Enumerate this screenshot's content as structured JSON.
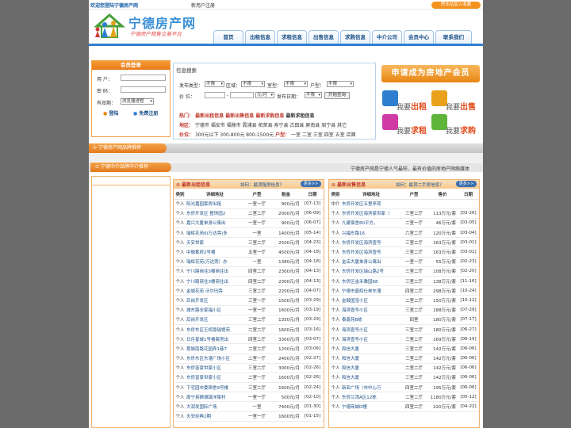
{
  "topbar": {
    "welcome": "欢迎您登陆宁德房产网",
    "register": "新用户注册",
    "favorite": "把本站加入收藏"
  },
  "logo": {
    "title": "宁德房产网",
    "slogan": "宁德房产租售交易平台"
  },
  "nav": [
    "首页",
    "出租信息",
    "求租信息",
    "出售信息",
    "求购信息",
    "中介公司",
    "会员中心",
    "联系我们"
  ],
  "login": {
    "header": "会员登录",
    "user_label": "用 户：",
    "password_label": "密 码：",
    "validity_label": "有效期：",
    "validity_value": "浏览器进程",
    "login_button": "登陆",
    "register_button": "免费注册"
  },
  "search": {
    "header": "信息搜索",
    "row1": {
      "type_label": "发布类型：",
      "type_value": "不限",
      "district_label": "区域：",
      "district_value": "不限",
      "rooms_label": "室型：",
      "rooms_value": "不限",
      "house_label": "户型：",
      "house_value": "不限"
    },
    "row2": {
      "price_label": "价    位：",
      "dash": "-",
      "unit_value": "元/月",
      "date_label": "发布日期：",
      "date_value": "不限",
      "button": "开始查询"
    },
    "hot": {
      "label": "热门：",
      "links": [
        "最新出租信息",
        "最新出售信息",
        "最新求购信息",
        "最新求租信息"
      ]
    },
    "district": {
      "label": "地区：",
      "text": "宁德市 福安市 福鼎市 霞浦县 柘荣县 寿宁县 古田县 屏南县 周宁县 其它"
    },
    "price": {
      "label": "价位：",
      "text": "300元以下 300-800元 800-1500元",
      "rooms_label": "户型：",
      "rooms_text": "一室 二室 三室 四室 五室 店面"
    }
  },
  "member": {
    "join": "申请成为房地产会员",
    "actions": [
      {
        "pre": "我要",
        "word": "出租",
        "color": "#2f7fd0"
      },
      {
        "pre": "我要",
        "word": "出售",
        "color": "#e9a11c"
      },
      {
        "pre": "我要",
        "word": "求租",
        "color": "#d03aa4"
      },
      {
        "pre": "我要",
        "word": "求购",
        "color": "#5fb53a"
      }
    ]
  },
  "promo": {
    "tag": "宁德房产网品牌推荐"
  },
  "agents": {
    "tag": "宁德中介品牌中介推荐",
    "marquee": "宁德房产网是宁德人气最旺、最有价值的房地产网络媒体"
  },
  "rent": {
    "title": "最新出租信息",
    "question": "如何：最顶租房信息？",
    "more": "更多>>",
    "headers": [
      "类别",
      "详细地址",
      "户型",
      "租金",
      "日期"
    ],
    "rows": [
      [
        "个人",
        "阳光嘉园套房出租",
        "一室一厅",
        "900元/月",
        "[07-13]"
      ],
      [
        "个人",
        "东侨开发区 整饰园2",
        "二室二厅",
        "2000元/月",
        "[06-09]"
      ],
      [
        "个人",
        "嘉兴大厦单身公寓出",
        "一室一厅",
        "900元/月",
        "[06-07]"
      ],
      [
        "个人",
        "瑞辉花苑6(万达旁)多",
        "一室",
        "1400元/月",
        "[05-14]"
      ],
      [
        "个人",
        "天安世家",
        "三室二厅",
        "2500元/月",
        "[04-23]"
      ],
      [
        "个人",
        "中融紫府2号楼",
        "五室一厅",
        "4500元/月",
        "[04-18]"
      ],
      [
        "个人",
        "瑞辉花苑(万达旁）办",
        "一室",
        "1380元/月",
        "[04-18]"
      ],
      [
        "个人",
        "宁川路商住3楼商住出",
        "四室二厅",
        "2300元/月",
        "[04-13]"
      ],
      [
        "个人",
        "宁川路商住3楼商住出",
        "四室二厅",
        "2300元/月",
        "[04-13]"
      ],
      [
        "个人",
        "金城花苑 沃尔玛旁",
        "三室二厅",
        "2200元/月",
        "[04-07]"
      ],
      [
        "个人",
        "后岗开发区",
        "三室一厅",
        "1500元/月",
        "[03-29]"
      ],
      [
        "个人",
        "城东路全家福小区",
        "一室一厅",
        "1600元/月",
        "[03-19]"
      ],
      [
        "个人",
        "后岗开发区",
        "三室二厅",
        "1350元/月",
        "[03-29]"
      ],
      [
        "个人",
        "东侨东区王机隐瑞馆苑",
        "二室二厅",
        "1600元/月",
        "[03-16]"
      ],
      [
        "个人",
        "日月星城1号楼套房出",
        "四室二厅",
        "3300元/月",
        "[03-07]"
      ],
      [
        "个人",
        "蕉城南路花园弄1巷7",
        "二室二厅",
        "1200元/月",
        "[03-06]"
      ],
      [
        "个人",
        "东侨东区东港广场小区",
        "二室一厅",
        "2400元/月",
        "[02-27]"
      ],
      [
        "个人",
        "东侨富豪世家小区",
        "三室二厅",
        "3000元/月",
        "[02-26]"
      ],
      [
        "个人",
        "东侨富豪世家小区",
        "二室一厅",
        "1600元/月",
        "[02-26]"
      ],
      [
        "个人",
        "下宅园市委宿舍9号楼",
        "三室二厅",
        "1600元/月",
        "[02-24]"
      ],
      [
        "个人",
        "周宁县狮城镇洋尾村",
        "一室一厅",
        "500元/月",
        "[02-10]"
      ],
      [
        "个人",
        "大润发国际广场",
        "一室",
        "7400元/月",
        "[01-30]"
      ],
      [
        "个人",
        "天安经典2期",
        "一室一厅",
        "1600元/月",
        "[01-15]"
      ]
    ]
  },
  "sale": {
    "title": "最新出售信息",
    "question": "如何：最顶二手房信息？",
    "more": "更多>>",
    "headers": [
      "类别",
      "详细地址",
      "户型",
      "售价",
      "日期"
    ],
    "rows": [
      [
        "中介",
        "东侨开发区五里亭荷",
        "",
        "",
        ""
      ],
      [
        "个人",
        "东侨开发区海滨豪世家（",
        "三室二厅",
        "113万元/套",
        "[03-26]"
      ],
      [
        "个人",
        "九建宿舍80平方，",
        "二室一厅",
        "46万元/套",
        "[03-05]"
      ],
      [
        "个人",
        "兴福东路16",
        "六室二厅",
        "120万元/套",
        "[03-04]"
      ],
      [
        "个人",
        "东侨开发区海滨壹号",
        "三室二厅",
        "163万元/套",
        "[03-01]"
      ],
      [
        "个人",
        "东侨开发区海滨壹号",
        "三室二厅",
        "163万元/套",
        "[03-01]"
      ],
      [
        "个人",
        "金店大厦单身公寓出",
        "一室一厅",
        "55万元/套",
        "[02-23]"
      ],
      [
        "个人",
        "东侨开发区瑞山路2号",
        "三室二厅",
        "108万元/套",
        "[02-20]"
      ],
      [
        "个人",
        "东侨区金禾雅园68",
        "三室二厅",
        "138万元/套",
        "[11-16]"
      ],
      [
        "个人",
        "宁德市盛辉仕林东涌",
        "四室二厅",
        "298万元/套",
        "[10-24]"
      ],
      [
        "个人",
        "金鼓国宝小区",
        "二室二厅",
        "150万元/套",
        "[10-12]"
      ],
      [
        "个人",
        "海滨壹号小区",
        "三室二厅",
        "188万元/套",
        "[07-29]"
      ],
      [
        "个人",
        "泰鑫苑B栋",
        "四室",
        "180万元/套",
        "[07-17]"
      ],
      [
        "个人",
        "海滨壹号小区",
        "三室二厅",
        "180万元/套",
        "[06-27]"
      ],
      [
        "个人",
        "海滨壹号小区",
        "三室二厅",
        "169万元/套",
        "[06-19]"
      ],
      [
        "个人",
        "和信大厦",
        "三室二厅",
        "142万元/套",
        "[06-06]"
      ],
      [
        "个人",
        "和信大厦",
        "三室二厅",
        "142万元/套",
        "[06-06]"
      ],
      [
        "个人",
        "和信大厦",
        "二室二厅",
        "142万元/套",
        "[06-06]"
      ],
      [
        "个人",
        "和信大厦",
        "三室二厅",
        "142万元/套",
        "[06-06]"
      ],
      [
        "个人",
        "新亚广场（市中心万",
        "四室二厅",
        "195万元/套",
        "[06-06]"
      ],
      [
        "个人",
        "东侨兰湾A区12栋",
        "二室二厅",
        "1180万元/套",
        "[05-12]"
      ],
      [
        "个人",
        "宁德商城D幢",
        "四室二厅",
        "220万元/套",
        "[04-22]"
      ]
    ]
  }
}
